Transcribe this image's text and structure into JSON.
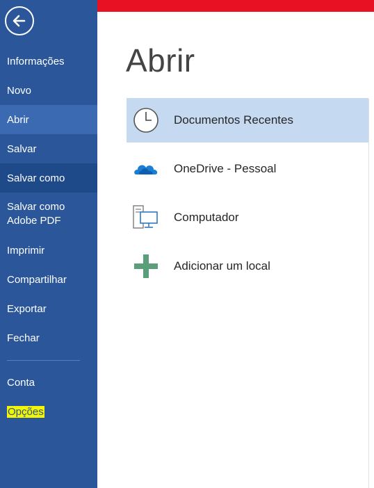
{
  "backstage": {
    "nav": {
      "items": [
        {
          "label": "Informações"
        },
        {
          "label": "Novo"
        },
        {
          "label": "Abrir"
        },
        {
          "label": "Salvar"
        },
        {
          "label": "Salvar como"
        },
        {
          "label": "Salvar como Adobe PDF"
        },
        {
          "label": "Imprimir"
        },
        {
          "label": "Compartilhar"
        },
        {
          "label": "Exportar"
        },
        {
          "label": "Fechar"
        },
        {
          "label": "Conta"
        },
        {
          "label": "Opções"
        }
      ],
      "selected": "Abrir"
    }
  },
  "main": {
    "title": "Abrir",
    "locations": [
      {
        "label": "Documentos Recentes",
        "icon": "clock-icon",
        "selected": true
      },
      {
        "label": "OneDrive - Pessoal",
        "icon": "onedrive-cloud-icon"
      },
      {
        "label": "Computador",
        "icon": "computer-icon"
      },
      {
        "label": "Adicionar um local",
        "icon": "plus-icon"
      }
    ]
  },
  "colors": {
    "sidebar": "#2b579a",
    "sidebar_selected": "#3b69b2",
    "sidebar_hover": "#1f4a8a",
    "top_bar": "#e81123",
    "location_selected": "#c5d9f1",
    "highlight": "#f5f500"
  }
}
